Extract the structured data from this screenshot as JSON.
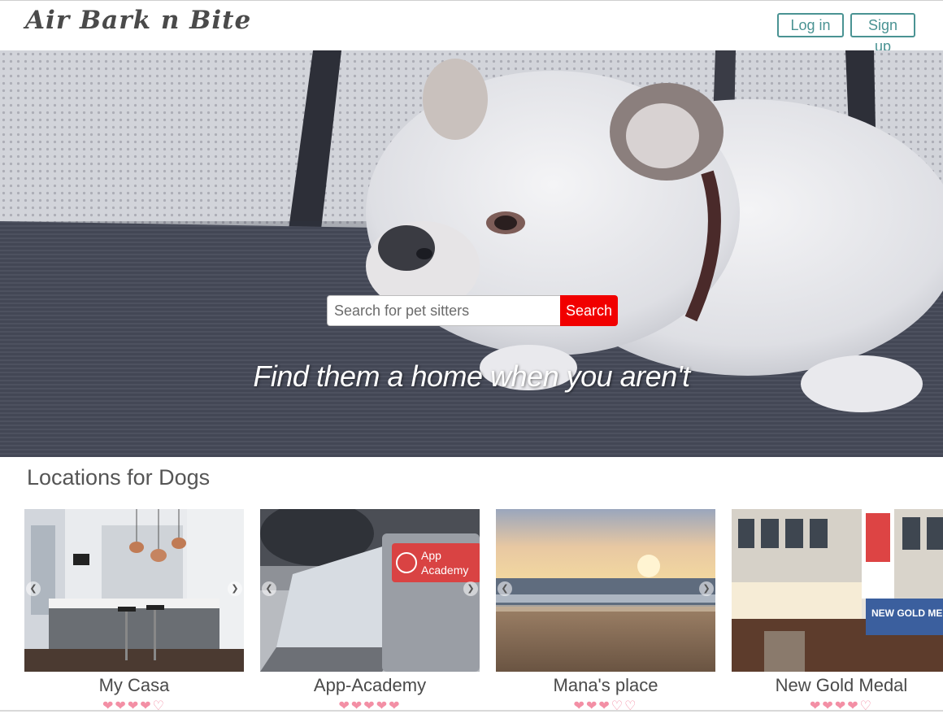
{
  "header": {
    "logo": "Air Bark n Bite",
    "login_label": "Log in",
    "signup_label": "Sign up"
  },
  "hero": {
    "search_placeholder": "Search for pet sitters",
    "search_button": "Search",
    "tagline": "Find them a home when you aren't"
  },
  "locations": {
    "title": "Locations for Dogs",
    "cards": [
      {
        "name": "My Casa",
        "rating": 4,
        "max_rating": 5
      },
      {
        "name": "App-Academy",
        "rating": 5,
        "max_rating": 5
      },
      {
        "name": "Mana's place",
        "rating": 3,
        "max_rating": 5
      },
      {
        "name": "New Gold Medal",
        "rating": 4,
        "max_rating": 5
      }
    ],
    "laptop_sticker_line1": "App",
    "laptop_sticker_line2": "Academy",
    "restaurant_sign": "NEW GOLD MEDAL"
  },
  "colors": {
    "accent_teal": "#4a9393",
    "search_red": "#f10000",
    "heart_pink": "#f38fa5"
  },
  "icons": {
    "carousel_prev": "chevron-left-icon",
    "carousel_next": "chevron-right-icon",
    "rating_heart": "heart-icon"
  }
}
